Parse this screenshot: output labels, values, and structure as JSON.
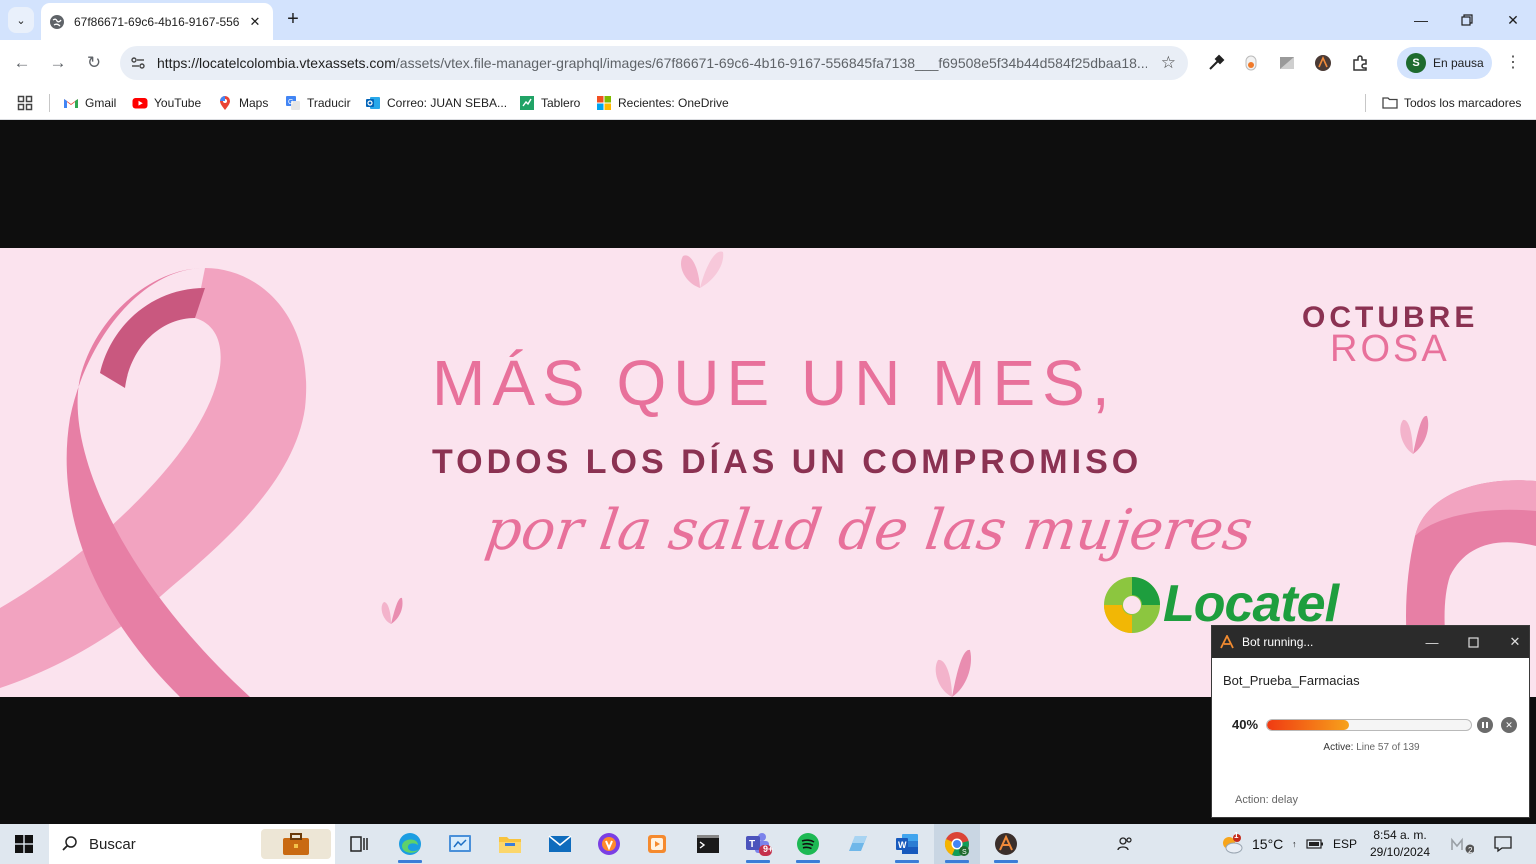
{
  "browser": {
    "tab": {
      "title": "67f86671-69c6-4b16-9167-556"
    },
    "url_host": "https://locatelcolombia.vtexassets.com",
    "url_path": "/assets/vtex.file-manager-graphql/images/67f86671-69c6-4b16-9167-556845fa7138___f69508e5f34b44d584f25dbaa18...",
    "profile": {
      "initial": "S",
      "label": "En pausa"
    },
    "bookmarks": [
      {
        "label": "Gmail",
        "icon": "gmail-icon"
      },
      {
        "label": "YouTube",
        "icon": "youtube-icon"
      },
      {
        "label": "Maps",
        "icon": "maps-icon"
      },
      {
        "label": "Traducir",
        "icon": "translate-icon"
      },
      {
        "label": "Correo: JUAN SEBA...",
        "icon": "outlook-icon"
      },
      {
        "label": "Tablero",
        "icon": "dashboard-icon"
      },
      {
        "label": "Recientes: OneDrive",
        "icon": "microsoft-icon"
      }
    ],
    "all_bookmarks": "Todos los marcadores"
  },
  "banner": {
    "headline": "MÁS QUE UN MES,",
    "subhead": "TODOS LOS DÍAS UN COMPROMISO",
    "script": "por la salud de las mujeres",
    "brand_top": "OCTUBRE",
    "brand_bottom": "ROSA",
    "logo_text": "Locatel",
    "colors": {
      "pink": "#e8719b",
      "plum": "#8b3252",
      "background": "#fbe3ee",
      "logo_green": "#1e9e3e"
    }
  },
  "bot": {
    "window_title": "Bot running...",
    "name": "Bot_Prueba_Farmacias",
    "progress_label": "40%",
    "progress": 0.4,
    "active_label": "Active:",
    "active_value": "Line 57 of 139",
    "action": "Action: delay"
  },
  "taskbar": {
    "search_label": "Buscar",
    "apps": [
      "task-view-icon",
      "edge-icon",
      "control-panel-icon",
      "file-explorer-icon",
      "mail-icon",
      "brave-icon",
      "media-player-icon",
      "terminal-icon",
      "teams-icon",
      "spotify-icon",
      "snipping-icon",
      "word-icon",
      "chrome-icon",
      "automation-icon"
    ],
    "teams_badge": "9+",
    "weather": "15°C",
    "weather_badge": "1",
    "language": "ESP",
    "time": "8:54 a. m.",
    "date": "29/10/2024",
    "notification_badge": "2"
  }
}
